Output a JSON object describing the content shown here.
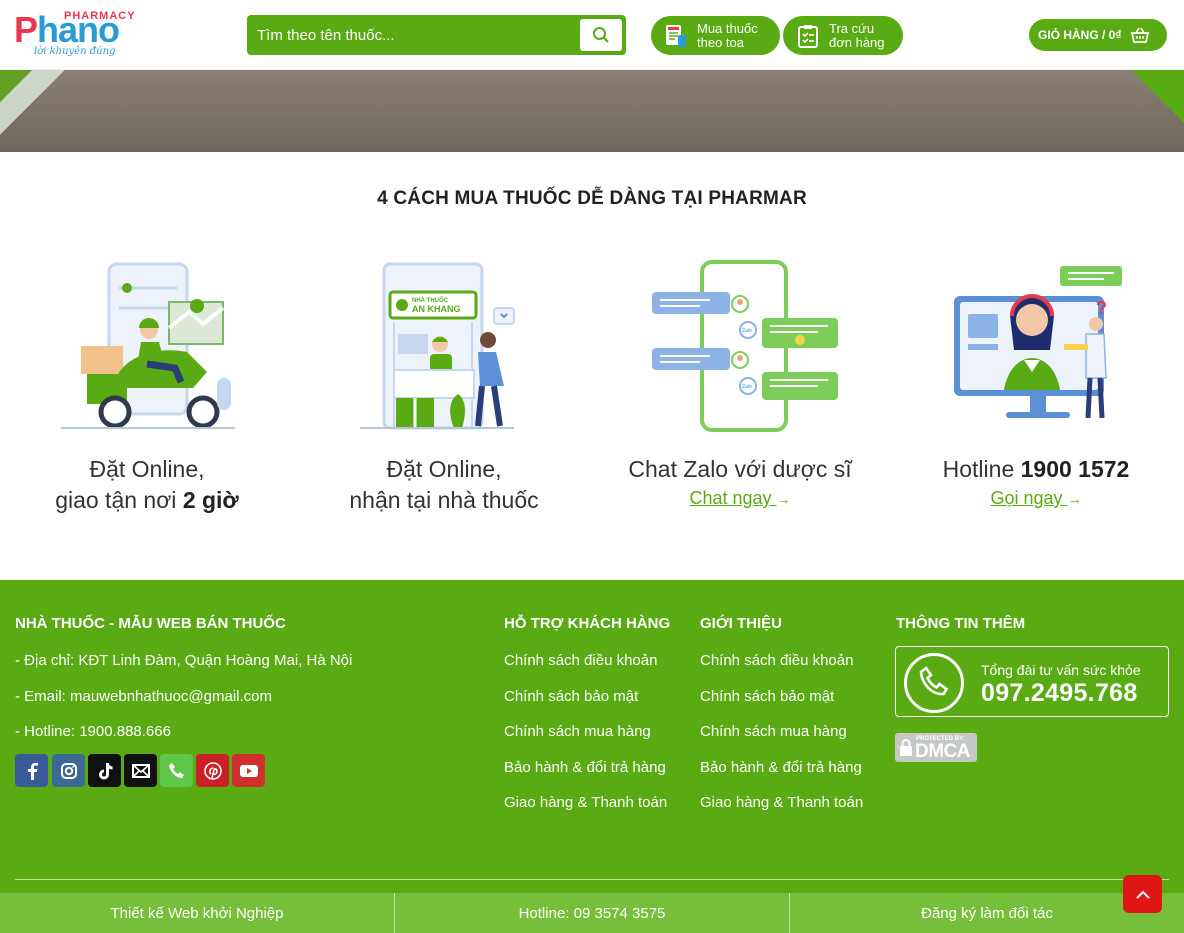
{
  "header": {
    "logo": {
      "brand_p": "P",
      "brand_rest": "hano",
      "pharmacy": "PHARMACY",
      "tagline": "lời khuyên đúng"
    },
    "search": {
      "placeholder": "Tìm theo tên thuốc..."
    },
    "buttons": [
      {
        "label_line1": "Mua thuốc",
        "label_line2": "theo toa"
      },
      {
        "label_line1": "Tra cứu",
        "label_line2": "đơn hàng"
      }
    ],
    "cart": {
      "label": "GIỎ HÀNG / 0₫"
    }
  },
  "how_to_buy": {
    "title": "4 CÁCH MUA THUỐC DỄ DÀNG TẠI PHARMAR",
    "cards": [
      {
        "line1": "Đặt Online,",
        "line2_prefix": "giao tận nơi ",
        "line2_bold": "2 giờ"
      },
      {
        "line1": "Đặt Online,",
        "line2": "nhận tại nhà thuốc",
        "store_sign_line1": "NHÀ THUỐC",
        "store_sign_line2": "AN KHANG"
      },
      {
        "line1": "Chat Zalo với dược sĩ",
        "link": "Chat ngay",
        "chat_label": "Zalo"
      },
      {
        "line1_prefix": "Hotline ",
        "line1_bold": "1900 1572",
        "link": "Gọi ngay"
      }
    ]
  },
  "footer": {
    "col1": {
      "heading": "NHÀ THUỐC - MẪU WEB BÁN THUỐC",
      "address": "- Địa chỉ: KĐT Linh Đàm, Quận Hoàng Mai, Hà Nội",
      "email": "- Email: mauwebnhathuoc@gmail.com",
      "hotline": "- Hotline: 1900.888.666"
    },
    "col2": {
      "heading": "HỖ TRỢ KHÁCH HÀNG",
      "links": [
        "Chính sách điều khoản",
        "Chính sách bảo mật",
        "Chính sách mua hàng",
        "Bảo hành & đổi trả hàng",
        "Giao hàng & Thanh toán"
      ]
    },
    "col3": {
      "heading": "GIỚI THIỆU",
      "links": [
        "Chính sách điều khoản",
        "Chính sách bảo mật",
        "Chính sách mua hàng",
        "Bảo hành & đổi trả hàng",
        "Giao hàng & Thanh toán"
      ]
    },
    "col4": {
      "heading": "THÔNG TIN THÊM",
      "consult_label": "Tổng đài tư vấn sức khỏe",
      "consult_number": "097.2495.768",
      "dmca_small": "PROTECTED BY:",
      "dmca_text": "DMCA"
    },
    "social_colors": {
      "facebook": "#3a5a98",
      "instagram": "#3b6994",
      "tiktok": "#111111",
      "email": "#111111",
      "phone": "#5fc84a",
      "pinterest": "#cb2027",
      "youtube": "#d0302b"
    }
  },
  "bottom_bar": [
    "Thiết kế Web khởi Nghiệp",
    "Hotline: 09 3574 3575",
    "Đăng ký làm đối tác"
  ],
  "colors": {
    "primary_green": "#5aaa14",
    "accent_red": "#e8384f",
    "blue": "#2b9bd6"
  }
}
